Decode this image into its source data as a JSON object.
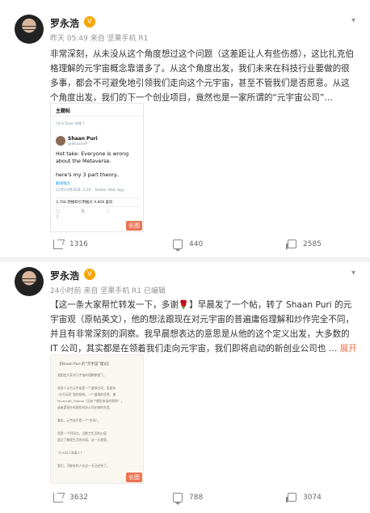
{
  "posts": [
    {
      "author": "罗永浩",
      "vip_badge": "V",
      "time": "昨天 05:49",
      "source": "来自 坚果手机 R1",
      "text": "非常深刻，从未没从这个角度想过这个问题（这差距让人有些伤感），这比扎克伯格理解的元宇宙概念靠谱多了。从这个角度出发，我们未来在科技行业要做的很多事，都会不可避免地引领我们走向这个元宇宙，甚至不管我们是否愿意。从这个角度出发，我们的下一个创业项目，竟然也是一家所谓的“元宇宙公司”…",
      "embed": {
        "header": "主题帖",
        "liked_by": "Chris Dixon 转推了",
        "tweet_name": "Shaan Puri",
        "tweet_handle": "@ShaanVP",
        "tweet_text": "Hot take: Everyone is wrong about the Metaverse.",
        "tweet_text2": "here's my 3 part theory..",
        "translate": "翻译推文",
        "tweet_meta": "21年10月30日, 2:26 · Twitter Web App",
        "tweet_stats": "3,768 转推和引用推文   9,808 喜欢",
        "long_badge": "长图"
      },
      "reposts": "1316",
      "comments": "440",
      "likes": "2585"
    },
    {
      "author": "罗永浩",
      "vip_badge": "V",
      "time": "24小时前",
      "source": "来自 坚果手机 R1 已编辑",
      "text": "【这一条大家帮忙转发一下，多谢🌹】早晨发了一个帖，转了 Shaan Puri 的元宇宙观（原帖英文），他的想法跟现在对元宇宙的普遍庸俗理解和炒作完全不同，并且有非常深刻的洞察。我早晨想表达的意思是从他的这个定义出发，大多数的 IT 公司，其实都是在领着我们走向元宇宙，我们即将启动的新创业公司也 …",
      "expand": "展开",
      "embed": {
        "title": "【Shaan Puri 的“元宇宙”理论】",
        "lines": [
          "我相信大家对元宇宙的理解都错了。",
          "很多人以为元宇宙是一个虚拟空间，里面有",
          "“头号玩家”里的那样。一个虚拟的世界，像",
          "Minecraft, Roblox（还有个模型来说的那种），",
          "或者是现在的那些科技公司在做的东西。",
          "事实，元宇宙不是一个“空间”。",
          "而是一个时间点，当数字生活的价值",
          "超过了物理生活的价值，这一天就是。",
          "“什么叫人和真人？”",
          "我们，可能有的人在这一天已经到了。"
        ],
        "long_badge": "长图"
      },
      "reposts": "3632",
      "comments": "788",
      "likes": "3074"
    }
  ]
}
